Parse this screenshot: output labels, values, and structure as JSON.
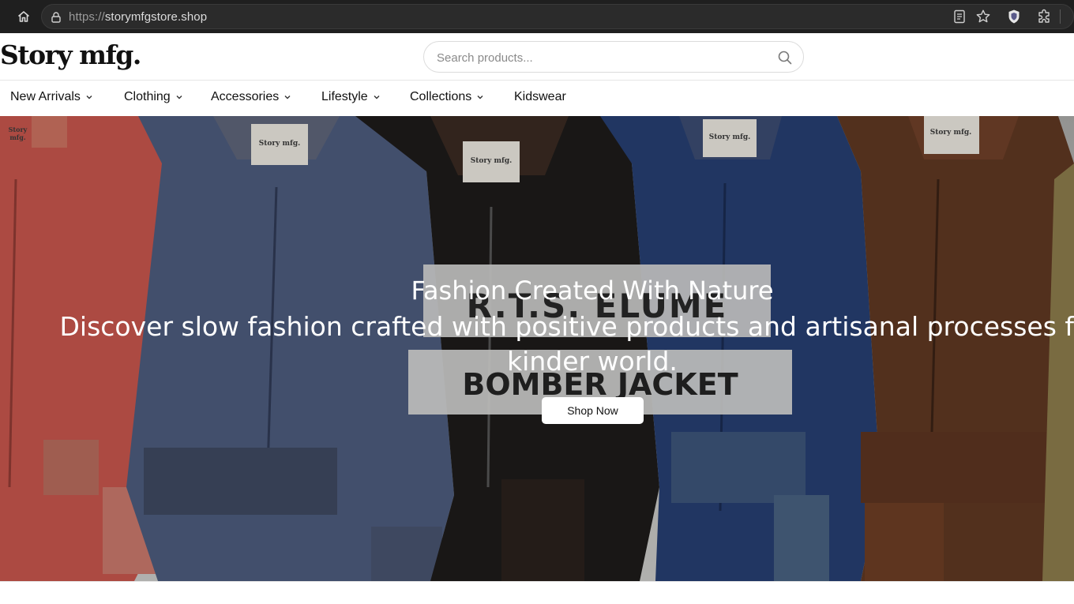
{
  "browser": {
    "url_scheme": "https://",
    "url_host": "storymfgstore.shop"
  },
  "header": {
    "logo_text": "Story mfg.",
    "search_placeholder": "Search products..."
  },
  "nav": {
    "items": [
      {
        "label": "New Arrivals",
        "has_dropdown": true
      },
      {
        "label": "Clothing",
        "has_dropdown": true
      },
      {
        "label": "Accessories",
        "has_dropdown": true
      },
      {
        "label": "Lifestyle",
        "has_dropdown": true
      },
      {
        "label": "Collections",
        "has_dropdown": true
      },
      {
        "label": "Kidswear",
        "has_dropdown": false
      }
    ]
  },
  "hero": {
    "title": "Fashion Created With Nature",
    "subtitle_line1": "Discover slow fashion crafted with positive products and artisanal processes for a",
    "subtitle_line2": "kinder world.",
    "button_label": "Shop Now",
    "sign_line1": "R.T.S. ELUME",
    "sign_line2": "BOMBER JACKET",
    "tag_text": "Story mfg."
  },
  "colors": {
    "browser_bg": "#1f1f1f",
    "url_text": "#dcdcdc",
    "hero_text": "#ffffff",
    "button_bg": "#ffffff"
  }
}
